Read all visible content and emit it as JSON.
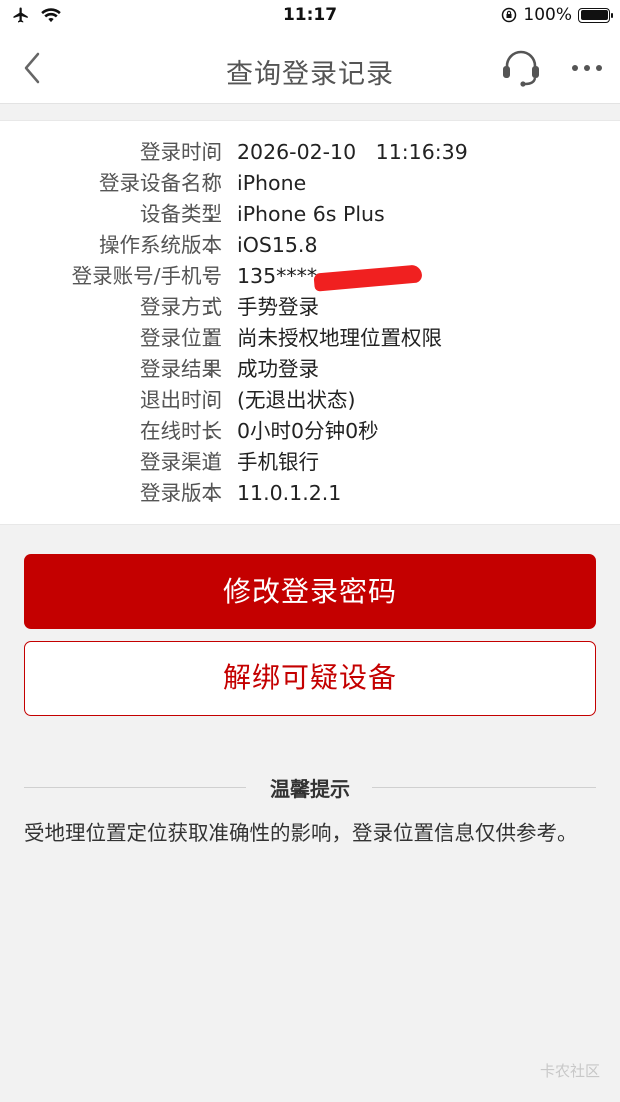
{
  "status_bar": {
    "time": "11:17",
    "battery": "100%",
    "icons": [
      "airplane-icon",
      "wifi-icon",
      "orientation-lock-icon",
      "battery-icon"
    ]
  },
  "nav": {
    "title": "查询登录记录",
    "icons": [
      "back-icon",
      "customer-service-icon",
      "more-icon"
    ]
  },
  "login_record": [
    {
      "label": "登录时间",
      "value": "2026-02-10   11:16:39"
    },
    {
      "label": "登录设备名称",
      "value": "iPhone"
    },
    {
      "label": "设备类型",
      "value": "iPhone 6s Plus"
    },
    {
      "label": "操作系统版本",
      "value": "iOS15.8"
    },
    {
      "label": "登录账号/手机号",
      "value": "135****"
    },
    {
      "label": "登录方式",
      "value": "手势登录"
    },
    {
      "label": "登录位置",
      "value": "尚未授权地理位置权限"
    },
    {
      "label": "登录结果",
      "value": "成功登录"
    },
    {
      "label": "退出时间",
      "value": "(无退出状态)"
    },
    {
      "label": "在线时长",
      "value": "0小时0分钟0秒"
    },
    {
      "label": "登录渠道",
      "value": "手机银行"
    },
    {
      "label": "登录版本",
      "value": "11.0.1.2.1"
    }
  ],
  "colon": "：",
  "buttons": {
    "change_password": "修改登录密码",
    "unbind_device": "解绑可疑设备"
  },
  "tips": {
    "title": "温馨提示",
    "text": "受地理位置定位获取准确性的影响，登录位置信息仅供参考。"
  },
  "watermark": "卡农社区",
  "colors": {
    "primary_red": "#c40000",
    "background": "#f2f2f2",
    "redaction": "#f02020"
  }
}
